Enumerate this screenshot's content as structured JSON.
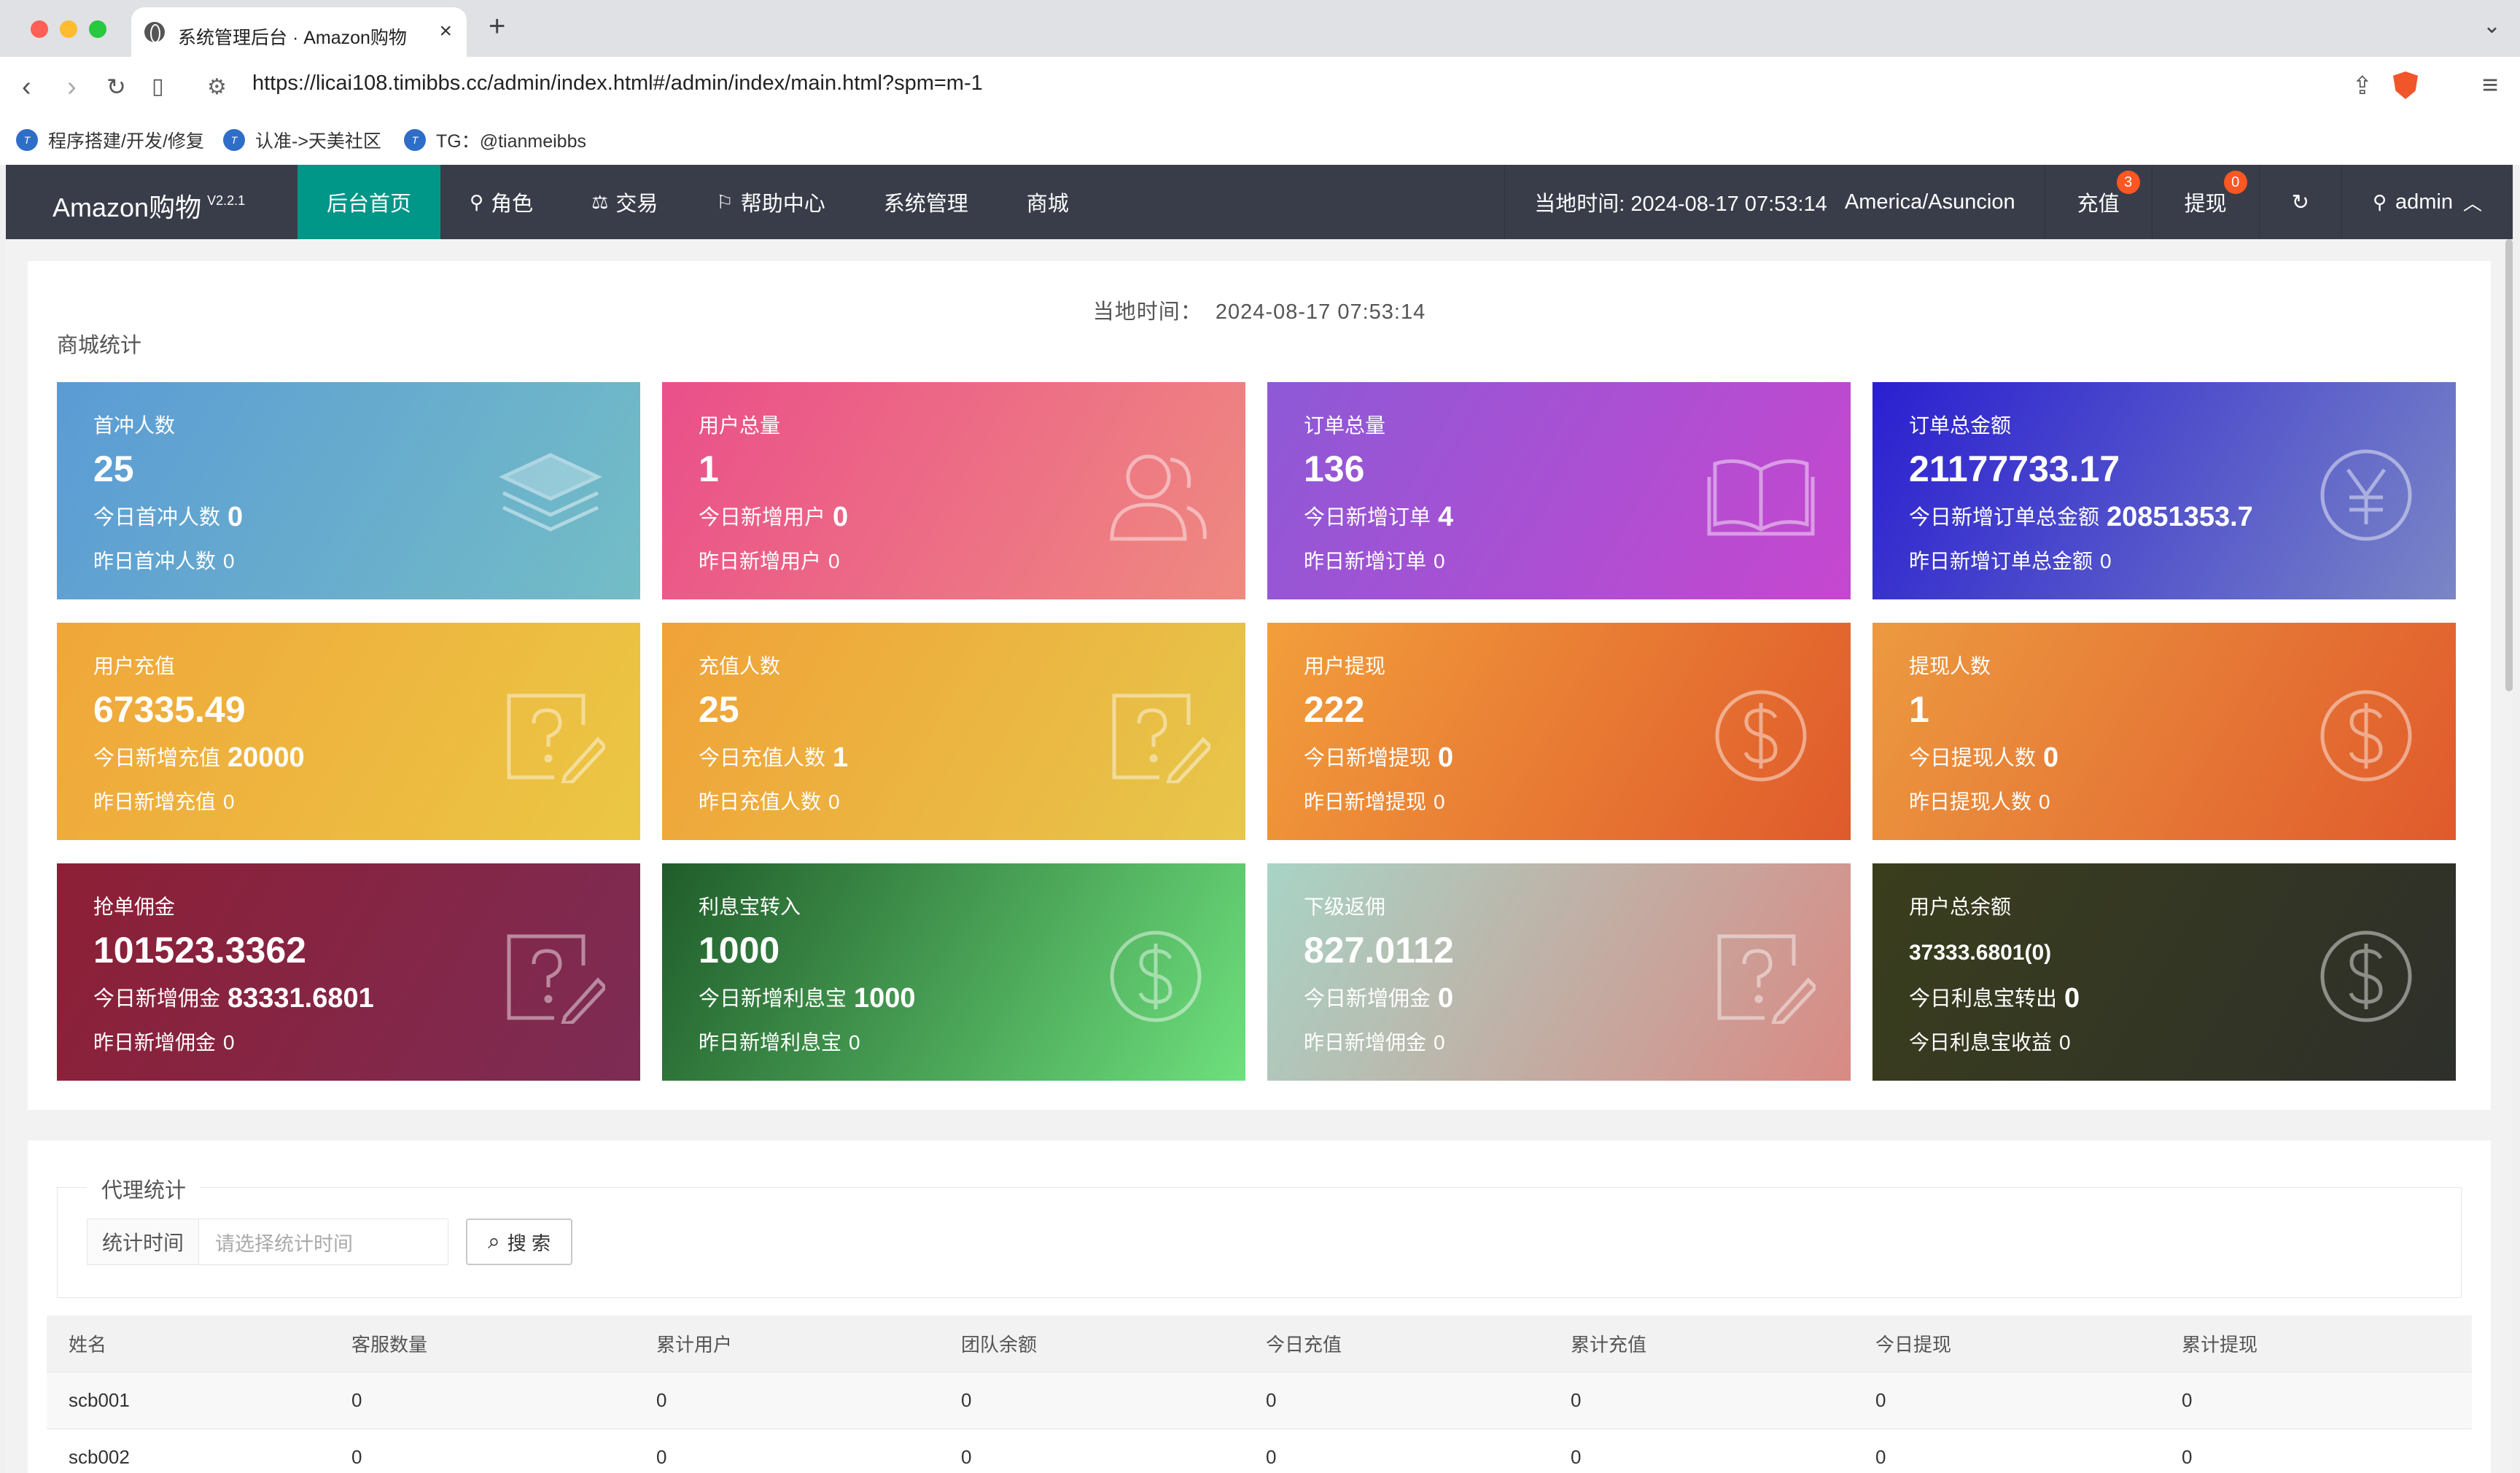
{
  "browser": {
    "tab_title": "系统管理后台 · Amazon购物",
    "url": "https://licai108.timibbs.cc/admin/index.html#/admin/index/main.html?spm=m-1",
    "bookmarks": [
      "程序搭建/开发/修复",
      "认准->天美社区",
      "TG：@tianmeibbs"
    ]
  },
  "header": {
    "brand": "Amazon购物",
    "version": "V2.2.1",
    "nav": [
      {
        "label": "后台首页",
        "icon": ""
      },
      {
        "label": "角色",
        "icon": "user-icon"
      },
      {
        "label": "交易",
        "icon": "scale-icon"
      },
      {
        "label": "帮助中心",
        "icon": "flag-icon"
      },
      {
        "label": "系统管理",
        "icon": ""
      },
      {
        "label": "商城",
        "icon": ""
      }
    ],
    "local_time": "当地时间: 2024-08-17 07:53:14",
    "timezone": "America/Asuncion",
    "recharge_label": "充值",
    "recharge_badge": "3",
    "withdraw_label": "提现",
    "withdraw_badge": "0",
    "user": "admin"
  },
  "stats": {
    "local_time_label": "当地时间：",
    "local_time_value": "2024-08-17 07:53:14",
    "section_title": "商城统计",
    "cards": [
      {
        "label": "首冲人数",
        "value": "25",
        "today_label": "今日首冲人数",
        "today_value": "0",
        "yesterday_label": "昨日首冲人数",
        "yesterday_value": "0",
        "icon": "layers-icon"
      },
      {
        "label": "用户总量",
        "value": "1",
        "today_label": "今日新增用户",
        "today_value": "0",
        "yesterday_label": "昨日新增用户",
        "yesterday_value": "0",
        "icon": "users-icon"
      },
      {
        "label": "订单总量",
        "value": "136",
        "today_label": "今日新增订单",
        "today_value": "4",
        "yesterday_label": "昨日新增订单",
        "yesterday_value": "0",
        "icon": "book-icon"
      },
      {
        "label": "订单总金额",
        "value": "21177733.17",
        "today_label": "今日新增订单总金额",
        "today_value": "20851353.7",
        "yesterday_label": "昨日新增订单总金额",
        "yesterday_value": "0",
        "icon": "yen-icon"
      },
      {
        "label": "用户充值",
        "value": "67335.49",
        "today_label": "今日新增充值",
        "today_value": "20000",
        "yesterday_label": "昨日新增充值",
        "yesterday_value": "0",
        "icon": "question-edit-icon"
      },
      {
        "label": "充值人数",
        "value": "25",
        "today_label": "今日充值人数",
        "today_value": "1",
        "yesterday_label": "昨日充值人数",
        "yesterday_value": "0",
        "icon": "question-edit-icon"
      },
      {
        "label": "用户提现",
        "value": "222",
        "today_label": "今日新增提现",
        "today_value": "0",
        "yesterday_label": "昨日新增提现",
        "yesterday_value": "0",
        "icon": "dollar-icon"
      },
      {
        "label": "提现人数",
        "value": "1",
        "today_label": "今日提现人数",
        "today_value": "0",
        "yesterday_label": "昨日提现人数",
        "yesterday_value": "0",
        "icon": "dollar-icon"
      },
      {
        "label": "抢单佣金",
        "value": "101523.3362",
        "today_label": "今日新增佣金",
        "today_value": "83331.6801",
        "yesterday_label": "昨日新增佣金",
        "yesterday_value": "0",
        "icon": "question-edit-icon"
      },
      {
        "label": "利息宝转入",
        "value": "1000",
        "today_label": "今日新增利息宝",
        "today_value": "1000",
        "yesterday_label": "昨日新增利息宝",
        "yesterday_value": "0",
        "icon": "dollar-icon"
      },
      {
        "label": "下级返佣",
        "value": "827.0112",
        "today_label": "今日新增佣金",
        "today_value": "0",
        "yesterday_label": "昨日新增佣金",
        "yesterday_value": "0",
        "icon": "question-edit-icon"
      },
      {
        "label": "用户总余额",
        "value": "37333.6801(0)",
        "today_label": "今日利息宝转出",
        "today_value": "0",
        "yesterday_label": "今日利息宝收益",
        "yesterday_value": "0",
        "icon": "dollar-icon"
      }
    ]
  },
  "agent": {
    "legend": "代理统计",
    "filter_label": "统计时间",
    "filter_placeholder": "请选择统计时间",
    "search_label": "搜 索",
    "columns": [
      "姓名",
      "客服数量",
      "累计用户",
      "团队余额",
      "今日充值",
      "累计充值",
      "今日提现",
      "累计提现"
    ],
    "rows": [
      [
        "scb001",
        "0",
        "0",
        "0",
        "0",
        "0",
        "0",
        "0"
      ],
      [
        "scb002",
        "0",
        "0",
        "0",
        "0",
        "0",
        "0",
        "0"
      ]
    ]
  }
}
